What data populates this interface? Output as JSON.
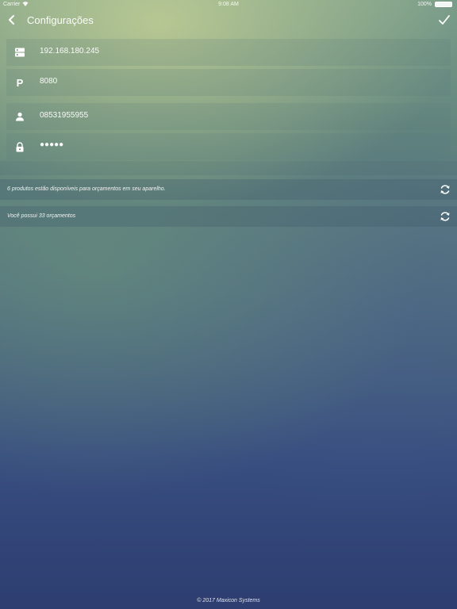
{
  "status_bar": {
    "carrier": "Carrier",
    "time": "9:08 AM",
    "battery": "100%"
  },
  "nav": {
    "title": "Configurações"
  },
  "fields": {
    "server": {
      "icon": "server-icon",
      "value": "192.168.180.245"
    },
    "port": {
      "icon": "parking-p-icon",
      "glyph": "P",
      "value": "8080"
    },
    "user": {
      "icon": "person-icon",
      "value": "08531955955"
    },
    "password": {
      "icon": "lock-icon",
      "value": "●●●●●"
    }
  },
  "info": {
    "products_text": "6 produtos estão disponíveis para orçamentos em seu aparelho.",
    "budgets_text": "Você possui 33 orçamentos"
  },
  "footer": {
    "copyright": "© 2017 Maxicon Systems"
  }
}
